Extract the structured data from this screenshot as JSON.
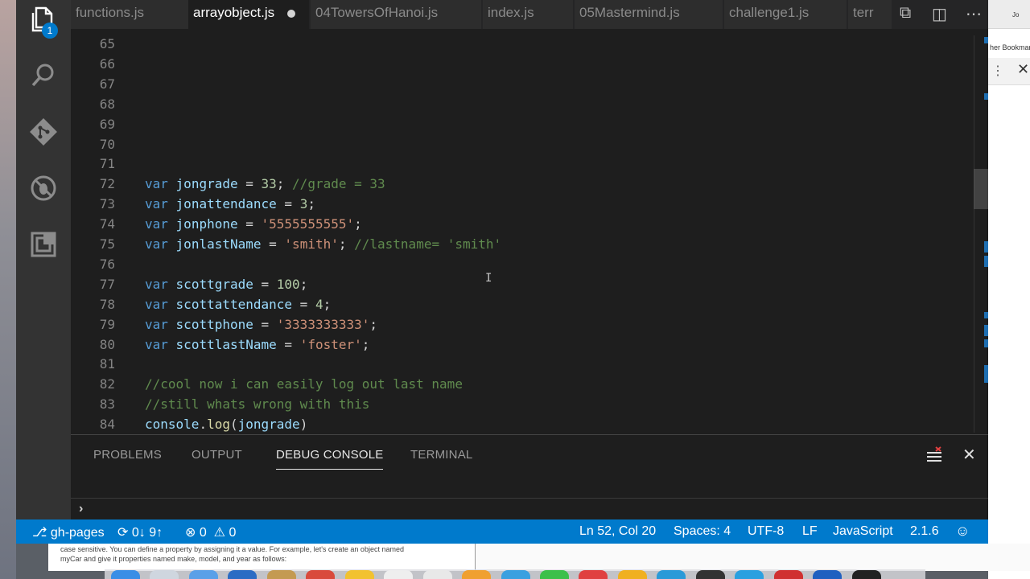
{
  "tabs": [
    {
      "label": "functions.js",
      "active": false
    },
    {
      "label": "arrayobject.js",
      "active": true,
      "dirty": true
    },
    {
      "label": "04TowersOfHanoi.js",
      "active": false
    },
    {
      "label": "index.js",
      "active": false
    },
    {
      "label": "05Mastermind.js",
      "active": false
    },
    {
      "label": "challenge1.js",
      "active": false
    },
    {
      "label": "terr",
      "active": false
    }
  ],
  "activity_bar": {
    "explorer_badge": "1",
    "icons": [
      "files-icon",
      "search-icon",
      "git-icon",
      "debug-icon",
      "extensions-icon"
    ]
  },
  "editor": {
    "lines": [
      {
        "n": "65",
        "tokens": []
      },
      {
        "n": "66",
        "tokens": []
      },
      {
        "n": "67",
        "tokens": []
      },
      {
        "n": "68",
        "tokens": []
      },
      {
        "n": "69",
        "tokens": []
      },
      {
        "n": "70",
        "tokens": []
      },
      {
        "n": "71",
        "tokens": []
      },
      {
        "n": "72",
        "tokens": [
          [
            "kw",
            "var"
          ],
          [
            "p",
            " "
          ],
          [
            "var",
            "jongrade"
          ],
          [
            "p",
            " = "
          ],
          [
            "num",
            "33"
          ],
          [
            "p",
            "; "
          ],
          [
            "cm",
            "//grade = 33"
          ]
        ]
      },
      {
        "n": "73",
        "tokens": [
          [
            "kw",
            "var"
          ],
          [
            "p",
            " "
          ],
          [
            "var",
            "jonattendance"
          ],
          [
            "p",
            " = "
          ],
          [
            "num",
            "3"
          ],
          [
            "p",
            ";"
          ]
        ]
      },
      {
        "n": "74",
        "tokens": [
          [
            "kw",
            "var"
          ],
          [
            "p",
            " "
          ],
          [
            "var",
            "jonphone"
          ],
          [
            "p",
            " = "
          ],
          [
            "str",
            "'5555555555'"
          ],
          [
            "p",
            ";"
          ]
        ]
      },
      {
        "n": "75",
        "tokens": [
          [
            "kw",
            "var"
          ],
          [
            "p",
            " "
          ],
          [
            "var",
            "jonlastName"
          ],
          [
            "p",
            " = "
          ],
          [
            "str",
            "'smith'"
          ],
          [
            "p",
            "; "
          ],
          [
            "cm",
            "//lastname= 'smith'"
          ]
        ]
      },
      {
        "n": "76",
        "tokens": []
      },
      {
        "n": "77",
        "tokens": [
          [
            "kw",
            "var"
          ],
          [
            "p",
            " "
          ],
          [
            "var",
            "scottgrade"
          ],
          [
            "p",
            " = "
          ],
          [
            "num",
            "100"
          ],
          [
            "p",
            ";"
          ]
        ]
      },
      {
        "n": "78",
        "tokens": [
          [
            "kw",
            "var"
          ],
          [
            "p",
            " "
          ],
          [
            "var",
            "scottattendance"
          ],
          [
            "p",
            " = "
          ],
          [
            "num",
            "4"
          ],
          [
            "p",
            ";"
          ]
        ]
      },
      {
        "n": "79",
        "tokens": [
          [
            "kw",
            "var"
          ],
          [
            "p",
            " "
          ],
          [
            "var",
            "scottphone"
          ],
          [
            "p",
            " = "
          ],
          [
            "str",
            "'3333333333'"
          ],
          [
            "p",
            ";"
          ]
        ]
      },
      {
        "n": "80",
        "tokens": [
          [
            "kw",
            "var"
          ],
          [
            "p",
            " "
          ],
          [
            "var",
            "scottlastName"
          ],
          [
            "p",
            " = "
          ],
          [
            "str",
            "'foster'"
          ],
          [
            "p",
            ";"
          ]
        ]
      },
      {
        "n": "81",
        "tokens": []
      },
      {
        "n": "82",
        "tokens": [
          [
            "cm",
            "//cool now i can easily log out last name"
          ]
        ]
      },
      {
        "n": "83",
        "tokens": [
          [
            "cm",
            "//still whats wrong with this"
          ]
        ]
      },
      {
        "n": "84",
        "tokens": [
          [
            "var",
            "console"
          ],
          [
            "p",
            "."
          ],
          [
            "fn",
            "log"
          ],
          [
            "p",
            "("
          ],
          [
            "var",
            "jongrade"
          ],
          [
            "p",
            ")"
          ]
        ]
      }
    ]
  },
  "panel": {
    "tabs": [
      {
        "label": "PROBLEMS",
        "active": false
      },
      {
        "label": "OUTPUT",
        "active": false
      },
      {
        "label": "DEBUG CONSOLE",
        "active": true
      },
      {
        "label": "TERMINAL",
        "active": false
      }
    ],
    "prompt": "›"
  },
  "status": {
    "branch": "gh-pages",
    "sync": "0↓ 9↑",
    "errors": "0",
    "warnings": "0",
    "position": "Ln 52, Col 20",
    "spaces": "Spaces: 4",
    "encoding": "UTF-8",
    "eol": "LF",
    "language": "JavaScript",
    "version": "2.1.6",
    "accent": "#007acc"
  },
  "background": {
    "browser_bookmark_text": "her Bookmar",
    "browser_tab_text": "Jo",
    "doc_line1": "case sensitive. You can define a property by assigning it a value. For example, let's create an object named",
    "doc_line2": "myCar and give it properties named make, model, and year as follows:"
  }
}
